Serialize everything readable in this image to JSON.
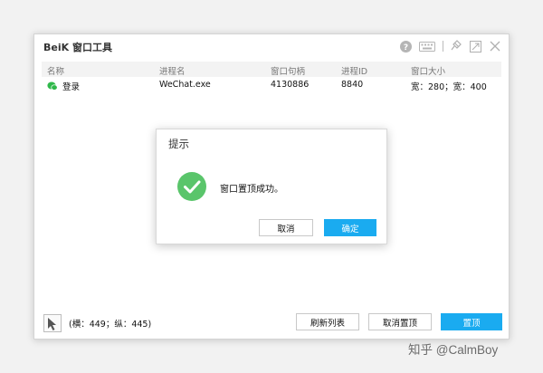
{
  "window": {
    "title": "BeiK 窗口工具",
    "controls": [
      "help-icon",
      "keyboard-icon",
      "pin-tool-icon",
      "restore-icon",
      "close-icon"
    ]
  },
  "table": {
    "columns": [
      "名称",
      "进程名",
      "窗口句柄",
      "进程ID",
      "窗口大小"
    ],
    "rows": [
      {
        "name": "登录",
        "process": "WeChat.exe",
        "handle": "4130886",
        "pid": "8840",
        "size": "宽：280；宽：400",
        "icon": "wechat-icon"
      }
    ]
  },
  "status": {
    "coords": "(横：449；纵：445)"
  },
  "buttons": {
    "refresh": "刷新列表",
    "unpin": "取消置顶",
    "pin": "置顶"
  },
  "dialog": {
    "title": "提示",
    "message": "窗口置顶成功。",
    "cancel": "取消",
    "ok": "确定"
  },
  "watermark": "知乎 @CalmBoy",
  "colors": {
    "accent": "#1aabf0",
    "success": "#5ac56b",
    "wechat": "#2fb84a"
  }
}
